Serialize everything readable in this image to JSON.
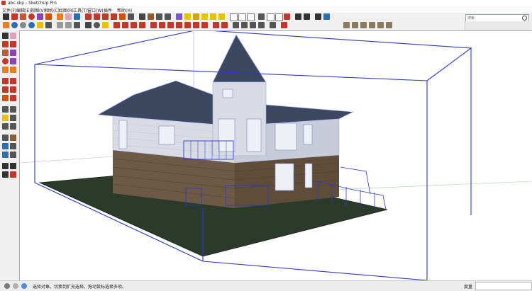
{
  "window": {
    "title": "abc.skp - SketchUp Pro"
  },
  "menu": [
    "文件(F)",
    "编辑(E)",
    "视图(V)",
    "相机(C)",
    "绘图(R)",
    "工具(T)",
    "窗口(W)",
    "插件",
    "帮助(H)"
  ],
  "search": {
    "placeholder": "搜索"
  },
  "status": {
    "message": "选择对象。切换到扩充选择。拖动鼠标选择多项。",
    "measure_label": "度量",
    "measure_value": ""
  },
  "colors": {
    "ground": "#2b3a2a",
    "bbox_line": "#2a39c8",
    "stone": "#6e5a44",
    "siding": "#d9dbe4",
    "roof": "#3c4860",
    "accent": "#b9c2ff"
  }
}
